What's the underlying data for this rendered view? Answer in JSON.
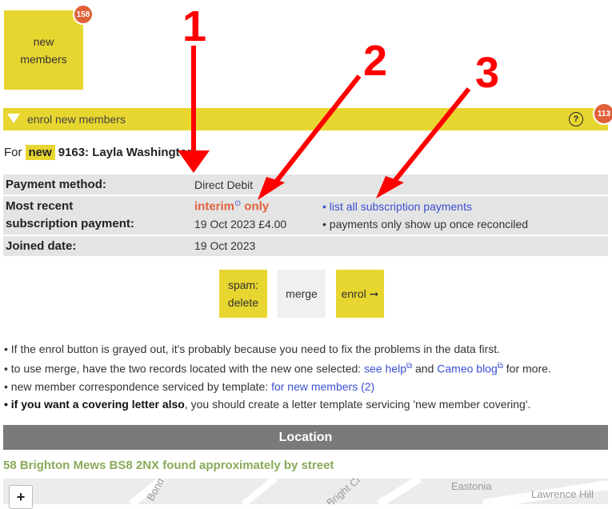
{
  "tile": {
    "label_line1": "new",
    "label_line2": "members",
    "badge": "158"
  },
  "enrol_bar": {
    "label": "enrol new members",
    "help": "?",
    "badge": "113"
  },
  "member": {
    "prefix": "For",
    "tag": "new",
    "id_name": "9163: Layla Washington"
  },
  "details": {
    "payment_method_label": "Payment method:",
    "payment_method_value": "Direct Debit",
    "recent_label_1": "Most recent",
    "recent_label_2": "subscription payment:",
    "recent_interim": "interim",
    "recent_only": "only",
    "recent_value": "19 Oct 2023 £4.00",
    "list_link": "• list all subscription payments",
    "reconcile_note": "• payments only show up once reconciled",
    "joined_label": "Joined date:",
    "joined_value": "19 Oct 2023"
  },
  "buttons": {
    "spam_1": "spam:",
    "spam_2": "delete",
    "merge": "merge",
    "enrol": "enrol ➞"
  },
  "bullets": {
    "b1": "• If the enrol button is grayed out, it's probably because you need to fix the problems in the data first.",
    "b2_pre": "• to use merge, have the two records located with the new one selected: ",
    "b2_help": "see help",
    "b2_and": " and ",
    "b2_blog": "Cameo blog",
    "b2_post": " for more.",
    "b3_pre": "• new member correspondence serviced by template: ",
    "b3_link": "for new members (2)",
    "b4_bold": "• if you want a covering letter also",
    "b4_rest": ", you should create a letter template servicing 'new member covering'."
  },
  "location": {
    "title": "Location",
    "address": "58 Brighton Mews BS8 2NX found approximately by street",
    "zoom_in": "+",
    "street_1": "Lawrence Hill",
    "street_2": "Eastonia",
    "street_3": "Bond",
    "street_4": "Bright Cr"
  },
  "annotations": {
    "n1": "1",
    "n2": "2",
    "n3": "3"
  },
  "colors": {
    "accent": "#e8d630",
    "badge": "#e0603a",
    "link": "#3a4fd0",
    "annotation": "#ff0000"
  }
}
